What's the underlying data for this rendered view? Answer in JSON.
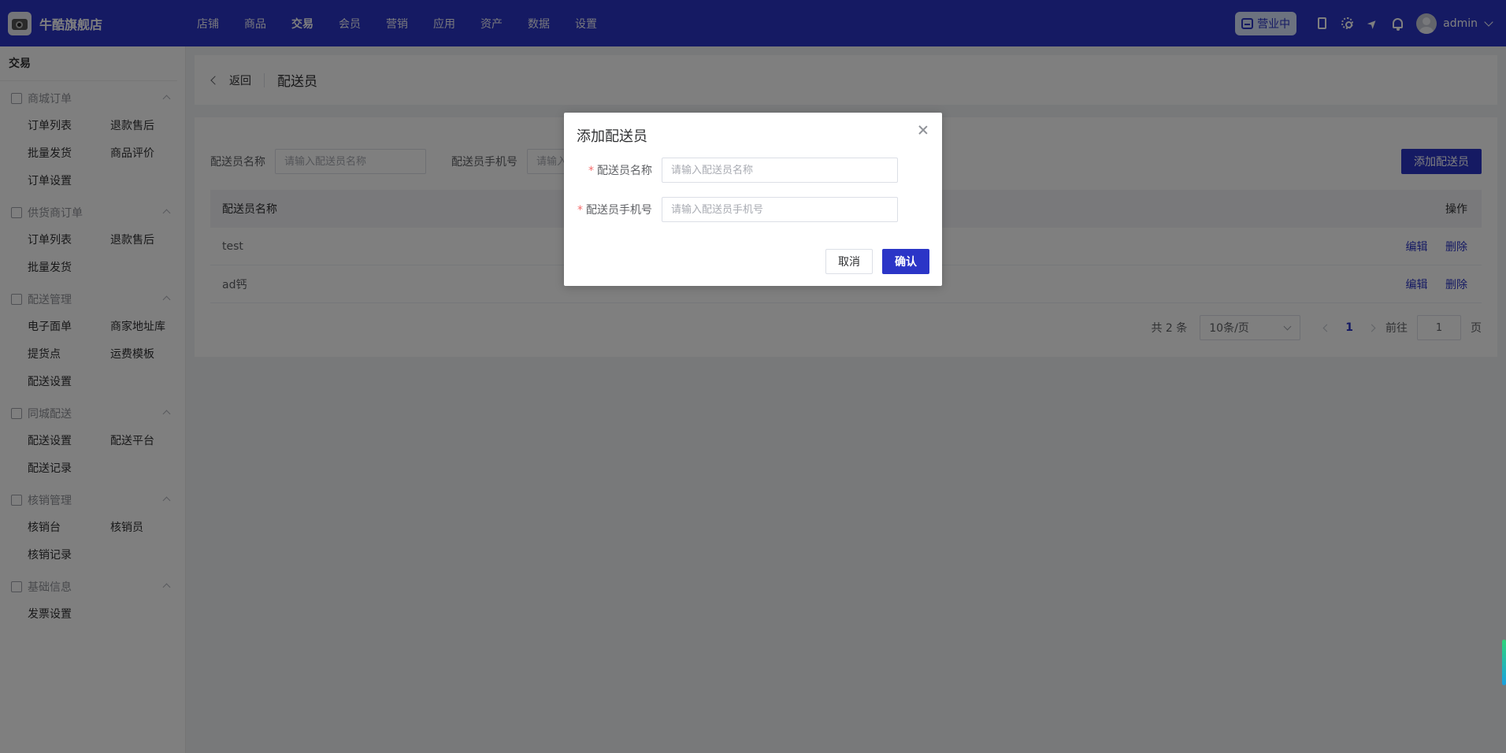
{
  "brand": {
    "name": "牛酷旗舰店",
    "logo_icon": "camera-logo"
  },
  "topnav": [
    {
      "label": "店铺",
      "active": false
    },
    {
      "label": "商品",
      "active": false
    },
    {
      "label": "交易",
      "active": true
    },
    {
      "label": "会员",
      "active": false
    },
    {
      "label": "营销",
      "active": false
    },
    {
      "label": "应用",
      "active": false
    },
    {
      "label": "资产",
      "active": false
    },
    {
      "label": "数据",
      "active": false
    },
    {
      "label": "设置",
      "active": false
    }
  ],
  "top_right": {
    "status": "营业中",
    "user": "admin"
  },
  "colors": {
    "primary": "#2b35c7",
    "danger": "#f56c6c"
  },
  "sidebar": {
    "title": "交易",
    "groups": [
      {
        "label": "商城订单",
        "icon": "order-icon",
        "items": [
          "订单列表",
          "退款售后",
          "批量发货",
          "商品评价",
          "订单设置"
        ]
      },
      {
        "label": "供货商订单",
        "icon": "supplier-icon",
        "items": [
          "订单列表",
          "退款售后",
          "批量发货"
        ]
      },
      {
        "label": "配送管理",
        "icon": "delivery-icon",
        "items": [
          "电子面单",
          "商家地址库",
          "提货点",
          "运费模板",
          "配送设置"
        ]
      },
      {
        "label": "同城配送",
        "icon": "truck-icon",
        "items": [
          "配送设置",
          "配送平台",
          "配送记录"
        ]
      },
      {
        "label": "核销管理",
        "icon": "verify-icon",
        "items": [
          "核销台",
          "核销员",
          "核销记录"
        ]
      },
      {
        "label": "基础信息",
        "icon": "info-icon",
        "items": [
          "发票设置"
        ]
      }
    ]
  },
  "header": {
    "back": "返回",
    "title": "配送员"
  },
  "filter": {
    "name_label": "配送员名称",
    "name_placeholder": "请输入配送员名称",
    "phone_label": "配送员手机号",
    "phone_placeholder": "请输入配送员手机号",
    "add_button": "添加配送员"
  },
  "table": {
    "columns": [
      "配送员名称",
      "操作"
    ],
    "rows": [
      {
        "name": "test",
        "actions": [
          "编辑",
          "删除"
        ]
      },
      {
        "name": "ad钙",
        "actions": [
          "编辑",
          "删除"
        ]
      }
    ]
  },
  "pagination": {
    "total": "共 2 条",
    "page_size": "10条/页",
    "current": "1",
    "goto_label": "前往",
    "goto_value": "1",
    "page_suffix": "页"
  },
  "dialog": {
    "title": "添加配送员",
    "name_label": "配送员名称",
    "name_placeholder": "请输入配送员名称",
    "phone_label": "配送员手机号",
    "phone_placeholder": "请输入配送员手机号",
    "cancel": "取消",
    "confirm": "确认"
  }
}
